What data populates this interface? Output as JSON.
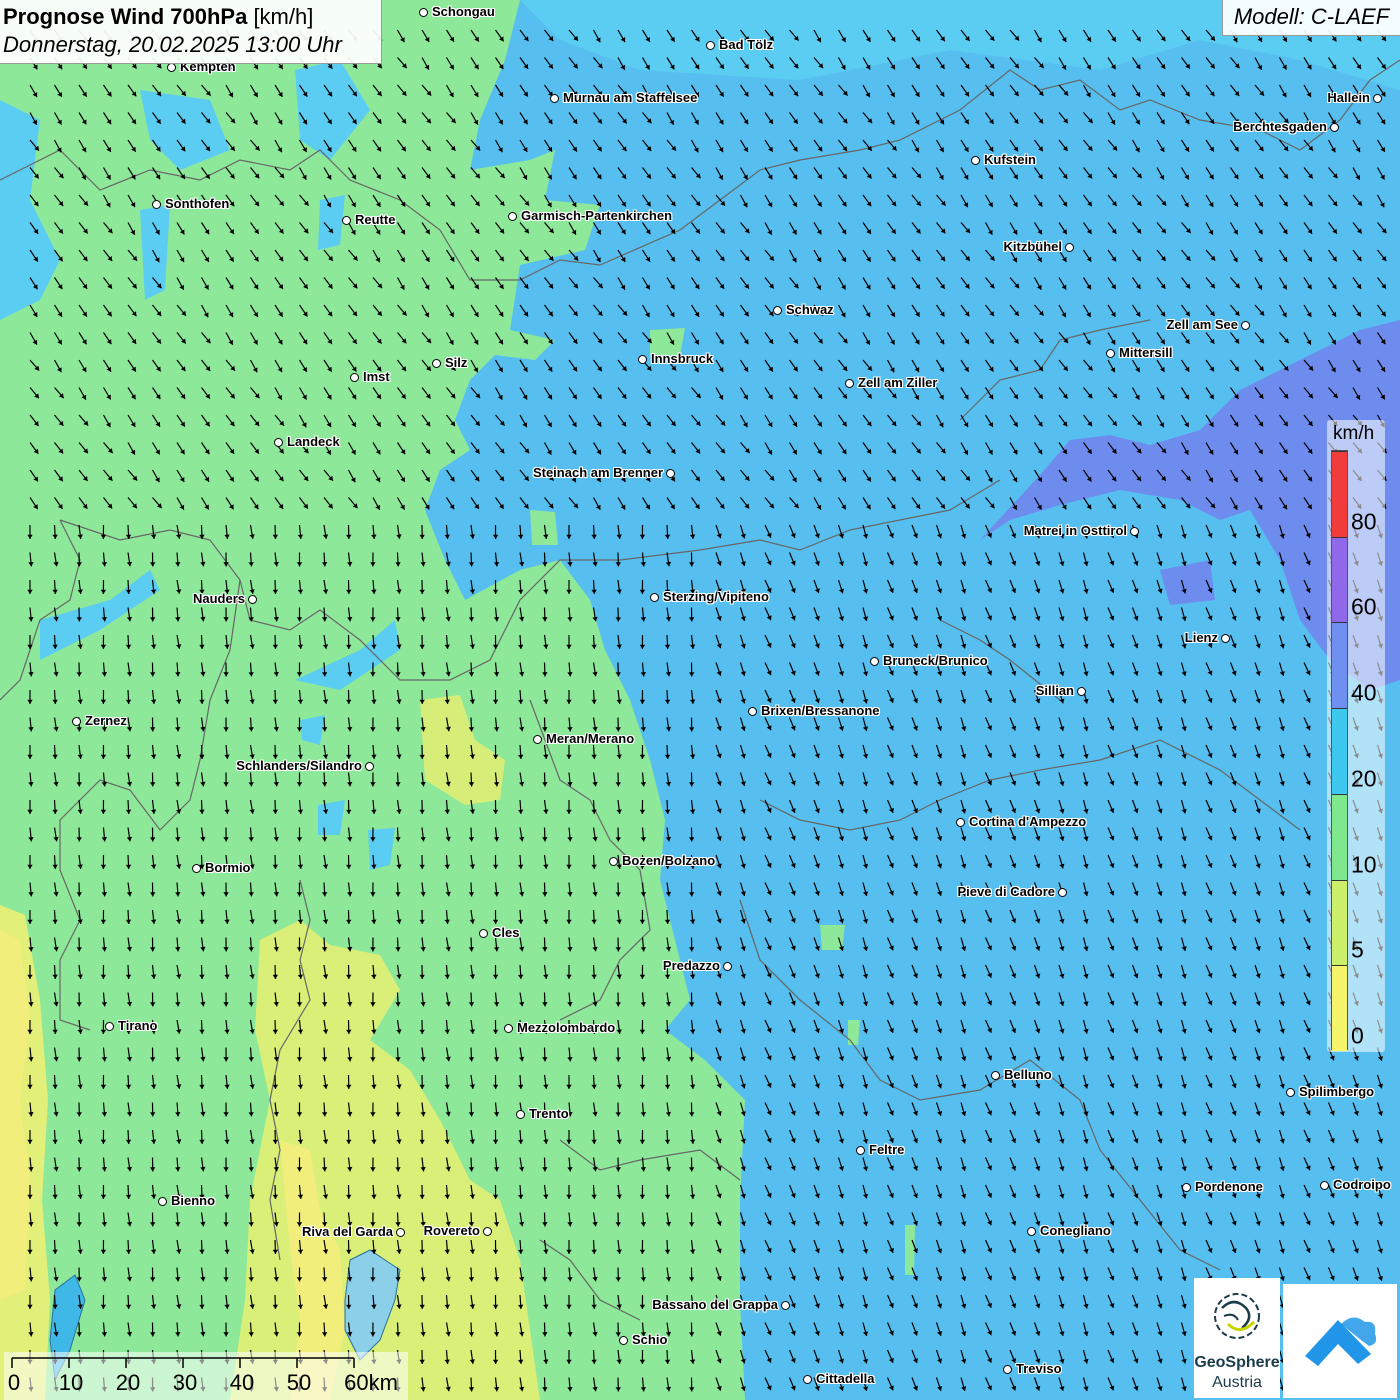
{
  "header": {
    "title_bold": "Prognose Wind 700hPa",
    "title_unit": "[km/h]",
    "date_line": "Donnerstag, 20.02.2025 13:00 Uhr",
    "model": "Modell: C-LAEF"
  },
  "legend": {
    "unit": "km/h",
    "ticks": [
      "0",
      "5",
      "10",
      "20",
      "40",
      "60",
      "80"
    ],
    "colors": [
      "#f6f46a",
      "#cdf06a",
      "#7fe88c",
      "#3cc8ef",
      "#6f90f0",
      "#9068ea",
      "#f23b3b"
    ]
  },
  "colors": {
    "calm_yellow": "#f3f088",
    "light_green": "#8ee89a",
    "cyan": "#5ed4f2",
    "blue": "#56bff0",
    "purple": "#6e8cee"
  },
  "scalebar": {
    "labels": [
      "0",
      "10",
      "20",
      "30",
      "40",
      "50",
      "60km"
    ]
  },
  "logos": {
    "geosphere_line1": "GeoSphere",
    "geosphere_line2": "Austria"
  },
  "cities": [
    {
      "name": "Schongau"
    },
    {
      "name": "Bad Tölz"
    },
    {
      "name": "Kempten"
    },
    {
      "name": "Murnau am Staffelsee"
    },
    {
      "name": "Hallein"
    },
    {
      "name": "Berchtesgaden"
    },
    {
      "name": "Kufstein"
    },
    {
      "name": "Sonthofen"
    },
    {
      "name": "Reutte"
    },
    {
      "name": "Garmisch-Partenkirchen"
    },
    {
      "name": "Kitzbühel"
    },
    {
      "name": "Schwaz"
    },
    {
      "name": "Zell am See"
    },
    {
      "name": "Mittersill"
    },
    {
      "name": "Innsbruck"
    },
    {
      "name": "Silz"
    },
    {
      "name": "Imst"
    },
    {
      "name": "Zell am Ziller"
    },
    {
      "name": "Landeck"
    },
    {
      "name": "Steinach am Brenner"
    },
    {
      "name": "Matrei in Osttirol"
    },
    {
      "name": "Nauders"
    },
    {
      "name": "Sterzing/Vipiteno"
    },
    {
      "name": "Lienz"
    },
    {
      "name": "Bruneck/Brunico"
    },
    {
      "name": "Sillian"
    },
    {
      "name": "Brixen/Bressanone"
    },
    {
      "name": "Zernez"
    },
    {
      "name": "Meran/Merano"
    },
    {
      "name": "Schlanders/Silandro"
    },
    {
      "name": "Cortina d'Ampezzo"
    },
    {
      "name": "Bozen/Bolzano"
    },
    {
      "name": "Bormio"
    },
    {
      "name": "Pieve di Cadore"
    },
    {
      "name": "Cles"
    },
    {
      "name": "Predazzo"
    },
    {
      "name": "Tirano"
    },
    {
      "name": "Mezzolombardo"
    },
    {
      "name": "Belluno"
    },
    {
      "name": "Spilimbergo"
    },
    {
      "name": "Trento"
    },
    {
      "name": "Feltre"
    },
    {
      "name": "Pordenone"
    },
    {
      "name": "Codroipo"
    },
    {
      "name": "Bienno"
    },
    {
      "name": "Riva del Garda"
    },
    {
      "name": "Rovereto"
    },
    {
      "name": "Conegliano"
    },
    {
      "name": "Bassano del Grappa"
    },
    {
      "name": "Schio"
    },
    {
      "name": "Treviso"
    },
    {
      "name": "Cittadella"
    }
  ]
}
